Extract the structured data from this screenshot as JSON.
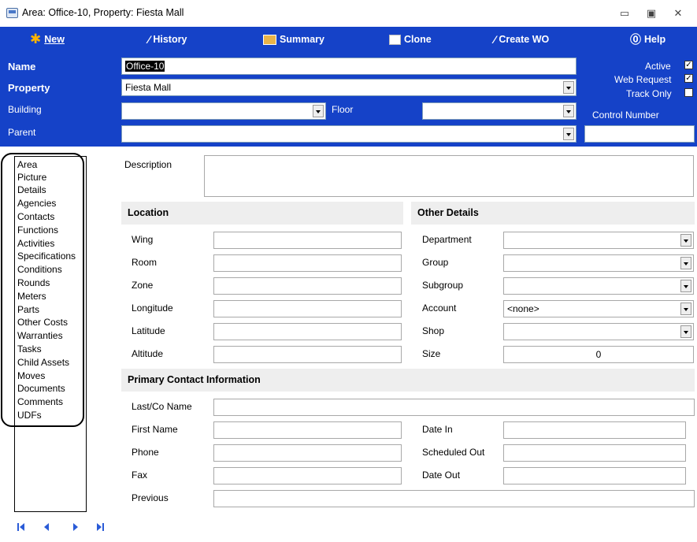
{
  "window": {
    "title": "Area: Office-10, Property: Fiesta Mall",
    "minimize_glyph": "▭",
    "maximize_glyph": "▣",
    "close_glyph": "✕"
  },
  "toolbar": {
    "new": "New",
    "history": "History",
    "summary": "Summary",
    "clone": "Clone",
    "create_wo": "Create WO",
    "help": "Help"
  },
  "header": {
    "name_label": "Name",
    "name_value": "Office-10",
    "property_label": "Property",
    "property_value": "Fiesta Mall",
    "building_label": "Building",
    "building_value": "",
    "floor_label": "Floor",
    "floor_value": "",
    "parent_label": "Parent",
    "parent_value": "",
    "active_label": "Active",
    "active_checked": true,
    "web_request_label": "Web Request",
    "web_request_checked": true,
    "track_only_label": "Track Only",
    "track_only_checked": false,
    "control_number_label": "Control Number",
    "control_number_value": ""
  },
  "nav": {
    "items": [
      "Area",
      "Picture",
      "Details",
      "Agencies",
      "Contacts",
      "Functions",
      "Activities",
      "Specifications",
      "Conditions",
      "Rounds",
      "Meters",
      "Parts",
      "Other Costs",
      "Warranties",
      "Tasks",
      "Child Assets",
      "Moves",
      "Documents",
      "Comments",
      "UDFs"
    ]
  },
  "form": {
    "description_label": "Description",
    "description_value": "",
    "location_title": "Location",
    "location": {
      "wing": "Wing",
      "room": "Room",
      "zone": "Zone",
      "longitude": "Longitude",
      "latitude": "Latitude",
      "altitude": "Altitude"
    },
    "other_title": "Other Details",
    "other": {
      "department": "Department",
      "group": "Group",
      "subgroup": "Subgroup",
      "account": "Account",
      "account_value": "<none>",
      "shop": "Shop",
      "size": "Size",
      "size_value": "0"
    },
    "contact_title": "Primary Contact Information",
    "contact": {
      "last_co_name": "Last/Co Name",
      "first_name": "First Name",
      "phone": "Phone",
      "fax": "Fax",
      "previous": "Previous",
      "date_in": "Date In",
      "scheduled_out": "Scheduled Out",
      "date_out": "Date Out"
    }
  },
  "icons": [
    "new-star-icon",
    "history-wand-icon",
    "summary-report-icon",
    "clone-icon",
    "create-wo-wand-icon",
    "help-icon",
    "first-record-icon",
    "prev-record-icon",
    "next-record-icon",
    "last-record-icon"
  ]
}
